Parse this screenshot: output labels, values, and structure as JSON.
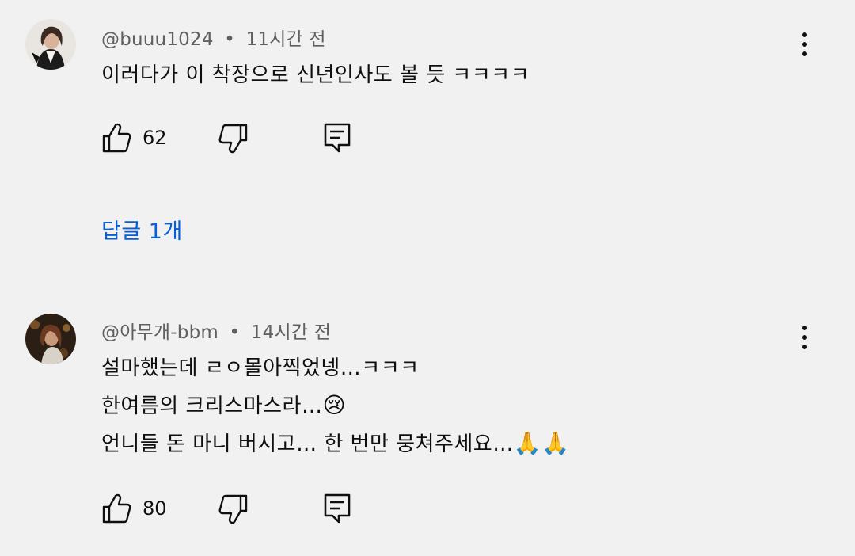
{
  "comments": [
    {
      "author": "@buuu1024",
      "separator": "•",
      "time": "11시간 전",
      "lines": [
        "이러다가 이 착장으로 신년인사도 볼 듯 ㅋㅋㅋㅋ"
      ],
      "likes": "62",
      "replies_label": "답글 1개"
    },
    {
      "author": "@아무개-bbm",
      "separator": "•",
      "time": "14시간 전",
      "lines": [
        "설마했는데 ㄹㅇ몰아찍었넹…ㅋㅋㅋ",
        "한여름의 크리스마스라…",
        "언니들 돈 마니 버시고… 한 번만 뭉쳐주세요…"
      ],
      "emoji_line2": "😢",
      "emoji_line3": "🙏🙏",
      "likes": "80"
    }
  ],
  "icons": {
    "like": "thumbs-up-icon",
    "dislike": "thumbs-down-icon",
    "reply": "reply-comment-icon",
    "menu": "more-vert-icon"
  },
  "colors": {
    "background": "#f1f1f1",
    "text": "#0f0f0f",
    "meta": "#606060",
    "link": "#065fd4"
  }
}
